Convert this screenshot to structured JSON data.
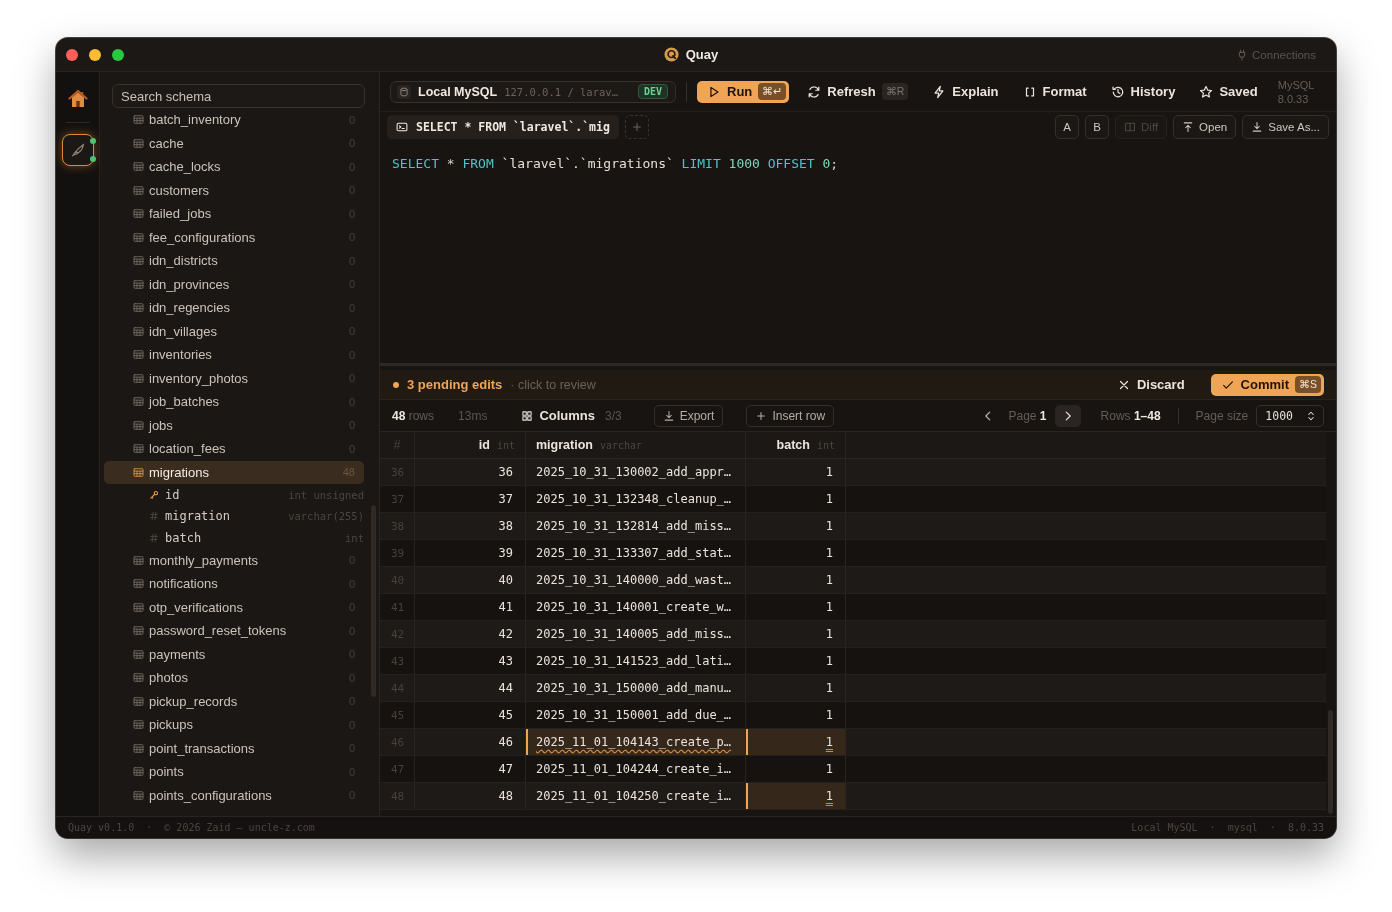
{
  "window": {
    "title": "Quay",
    "connections_link": "Connections"
  },
  "rail": {
    "items": [
      {
        "kind": "home",
        "selected": false
      },
      {
        "kind": "connection",
        "selected": true
      }
    ]
  },
  "sidebar": {
    "search": {
      "placeholder": "Search schema"
    },
    "tables": [
      {
        "name": "batch_inventory",
        "count": "0",
        "selected": false
      },
      {
        "name": "cache",
        "count": "0",
        "selected": false
      },
      {
        "name": "cache_locks",
        "count": "0",
        "selected": false
      },
      {
        "name": "customers",
        "count": "0",
        "selected": false
      },
      {
        "name": "failed_jobs",
        "count": "0",
        "selected": false
      },
      {
        "name": "fee_configurations",
        "count": "0",
        "selected": false
      },
      {
        "name": "idn_districts",
        "count": "0",
        "selected": false
      },
      {
        "name": "idn_provinces",
        "count": "0",
        "selected": false
      },
      {
        "name": "idn_regencies",
        "count": "0",
        "selected": false
      },
      {
        "name": "idn_villages",
        "count": "0",
        "selected": false
      },
      {
        "name": "inventories",
        "count": "0",
        "selected": false
      },
      {
        "name": "inventory_photos",
        "count": "0",
        "selected": false
      },
      {
        "name": "job_batches",
        "count": "0",
        "selected": false
      },
      {
        "name": "jobs",
        "count": "0",
        "selected": false
      },
      {
        "name": "location_fees",
        "count": "0",
        "selected": false
      },
      {
        "name": "migrations",
        "count": "48",
        "selected": true,
        "children": [
          {
            "name": "id",
            "type": "int unsigned",
            "kind": "primary_key"
          },
          {
            "name": "migration",
            "type": "varchar(255)",
            "kind": "column"
          },
          {
            "name": "batch",
            "type": "int",
            "kind": "column"
          }
        ]
      },
      {
        "name": "monthly_payments",
        "count": "0",
        "selected": false
      },
      {
        "name": "notifications",
        "count": "0",
        "selected": false
      },
      {
        "name": "otp_verifications",
        "count": "0",
        "selected": false
      },
      {
        "name": "password_reset_tokens",
        "count": "0",
        "selected": false
      },
      {
        "name": "payments",
        "count": "0",
        "selected": false
      },
      {
        "name": "photos",
        "count": "0",
        "selected": false
      },
      {
        "name": "pickup_records",
        "count": "0",
        "selected": false
      },
      {
        "name": "pickups",
        "count": "0",
        "selected": false
      },
      {
        "name": "point_transactions",
        "count": "0",
        "selected": false
      },
      {
        "name": "points",
        "count": "0",
        "selected": false
      },
      {
        "name": "points_configurations",
        "count": "0",
        "selected": false
      }
    ]
  },
  "toolbar": {
    "connection": {
      "name": "Local MySQL",
      "address": "127.0.0.1 / larav…",
      "environment": "DEV"
    },
    "actions": [
      {
        "kind": "run",
        "label": "Run",
        "shortcut": "⌘↵"
      },
      {
        "kind": "refresh",
        "label": "Refresh",
        "shortcut": "⌘R"
      },
      {
        "kind": "explain",
        "label": "Explain"
      },
      {
        "kind": "format",
        "label": "Format"
      },
      {
        "kind": "history",
        "label": "History"
      },
      {
        "kind": "saved",
        "label": "Saved"
      }
    ],
    "server": {
      "name": "MySQL",
      "version": "8.0.33"
    }
  },
  "editor": {
    "tabs": [
      {
        "label": "SELECT * FROM `laravel`.`mig",
        "selected": true
      }
    ],
    "actions": [
      {
        "kind": "compare",
        "label": "A",
        "disabled": false
      },
      {
        "kind": "compare",
        "label": "B",
        "disabled": false
      },
      {
        "kind": "diff",
        "label": "Diff",
        "disabled": true
      },
      {
        "kind": "open",
        "label": "Open",
        "disabled": false
      },
      {
        "kind": "save",
        "label": "Save As...",
        "disabled": false
      }
    ],
    "query": [
      {
        "kind": "keyword",
        "text": "SELECT"
      },
      {
        "kind": "operator",
        "text": "*"
      },
      {
        "kind": "keyword",
        "text": "FROM"
      },
      {
        "kind": "identifier",
        "text": "`laravel`.`migrations`"
      },
      {
        "kind": "keyword",
        "text": "LIMIT"
      },
      {
        "kind": "number",
        "text": "1000"
      },
      {
        "kind": "keyword",
        "text": "OFFSET"
      },
      {
        "kind": "number",
        "text": "0"
      },
      {
        "kind": "punct",
        "text": ";"
      }
    ]
  },
  "pending": {
    "summary": "3 pending edits",
    "hint": "· click to review",
    "discard": "Discard",
    "commit": {
      "label": "Commit",
      "shortcut": "⌘S"
    }
  },
  "results_toolbar": {
    "row_count": "**48** rows",
    "duration": "13ms",
    "columns": {
      "label": "Columns",
      "count": "3/3"
    },
    "export": "Export",
    "insert_row": "Insert row",
    "page": "Page **1**",
    "range": "Rows **1–48**",
    "page_size": {
      "label": "Page size",
      "value": "1000"
    }
  },
  "table": {
    "columns": [
      {
        "name": "#",
        "kind": "index"
      },
      {
        "name": "id",
        "type": "int",
        "kind": "number"
      },
      {
        "name": "migration",
        "type": "varchar",
        "kind": "text"
      },
      {
        "name": "batch",
        "type": "int",
        "kind": "number"
      }
    ],
    "rows": [
      {
        "cells": [
          {
            "text": "36",
            "edited": false
          },
          {
            "text": "36",
            "edited": false
          },
          {
            "text": "2025_10_31_130002_add_appr…",
            "edited": false
          },
          {
            "text": "1",
            "edited": false
          }
        ]
      },
      {
        "cells": [
          {
            "text": "37",
            "edited": false
          },
          {
            "text": "37",
            "edited": false
          },
          {
            "text": "2025_10_31_132348_cleanup_…",
            "edited": false
          },
          {
            "text": "1",
            "edited": false
          }
        ]
      },
      {
        "cells": [
          {
            "text": "38",
            "edited": false
          },
          {
            "text": "38",
            "edited": false
          },
          {
            "text": "2025_10_31_132814_add_miss…",
            "edited": false
          },
          {
            "text": "1",
            "edited": false
          }
        ]
      },
      {
        "cells": [
          {
            "text": "39",
            "edited": false
          },
          {
            "text": "39",
            "edited": false
          },
          {
            "text": "2025_10_31_133307_add_stat…",
            "edited": false
          },
          {
            "text": "1",
            "edited": false
          }
        ]
      },
      {
        "cells": [
          {
            "text": "40",
            "edited": false
          },
          {
            "text": "40",
            "edited": false
          },
          {
            "text": "2025_10_31_140000_add_wast…",
            "edited": false
          },
          {
            "text": "1",
            "edited": false
          }
        ]
      },
      {
        "cells": [
          {
            "text": "41",
            "edited": false
          },
          {
            "text": "41",
            "edited": false
          },
          {
            "text": "2025_10_31_140001_create_w…",
            "edited": false
          },
          {
            "text": "1",
            "edited": false
          }
        ]
      },
      {
        "cells": [
          {
            "text": "42",
            "edited": false
          },
          {
            "text": "42",
            "edited": false
          },
          {
            "text": "2025_10_31_140005_add_miss…",
            "edited": false
          },
          {
            "text": "1",
            "edited": false
          }
        ]
      },
      {
        "cells": [
          {
            "text": "43",
            "edited": false
          },
          {
            "text": "43",
            "edited": false
          },
          {
            "text": "2025_10_31_141523_add_lati…",
            "edited": false
          },
          {
            "text": "1",
            "edited": false
          }
        ]
      },
      {
        "cells": [
          {
            "text": "44",
            "edited": false
          },
          {
            "text": "44",
            "edited": false
          },
          {
            "text": "2025_10_31_150000_add_manu…",
            "edited": false
          },
          {
            "text": "1",
            "edited": false
          }
        ]
      },
      {
        "cells": [
          {
            "text": "45",
            "edited": false
          },
          {
            "text": "45",
            "edited": false
          },
          {
            "text": "2025_10_31_150001_add_due_…",
            "edited": false
          },
          {
            "text": "1",
            "edited": false
          }
        ]
      },
      {
        "cells": [
          {
            "text": "46",
            "edited": false
          },
          {
            "text": "46",
            "edited": false
          },
          {
            "text": "2025_11_01_104143_create_p…",
            "edited": true
          },
          {
            "text": "1",
            "edited": true
          }
        ]
      },
      {
        "cells": [
          {
            "text": "47",
            "edited": false
          },
          {
            "text": "47",
            "edited": false
          },
          {
            "text": "2025_11_01_104244_create_i…",
            "edited": false
          },
          {
            "text": "1",
            "edited": false
          }
        ]
      },
      {
        "cells": [
          {
            "text": "48",
            "edited": false
          },
          {
            "text": "48",
            "edited": false
          },
          {
            "text": "2025_11_01_104250_create_i…",
            "edited": false
          },
          {
            "text": "1",
            "edited": true
          }
        ]
      }
    ]
  },
  "status_bar": {
    "left": "Quay v0.1.0  ·  © 2026 Zaid — uncle-z.com",
    "right": "Local MySQL  ·  mysql  ·  8.0.33"
  }
}
